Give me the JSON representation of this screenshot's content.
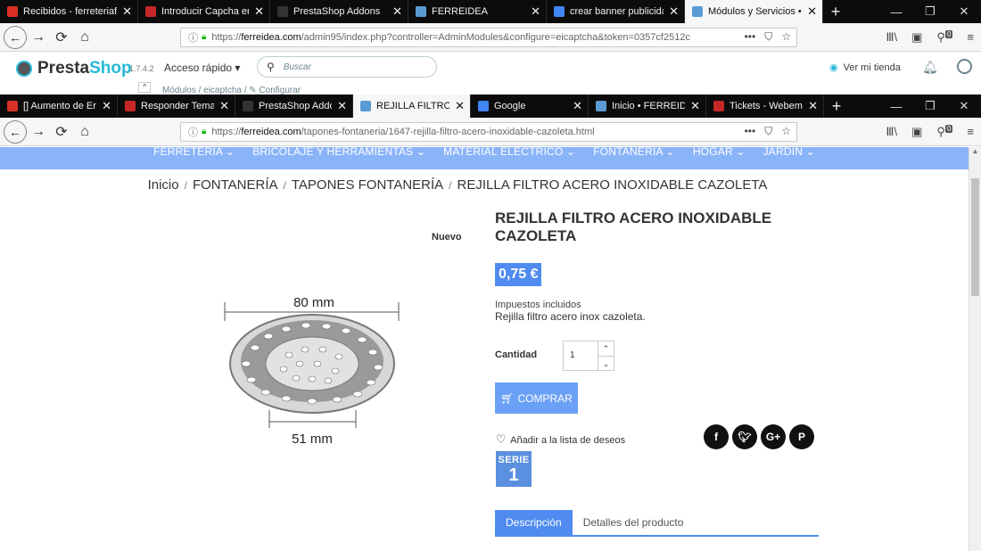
{
  "browser_back": {
    "tabs": [
      {
        "title": "Recibidos - ferreteriaferr",
        "favicon": "gmail-icon",
        "color": "#d93025",
        "w": 155
      },
      {
        "title": "Introducir Capcha en el f",
        "favicon": "webempresa-icon",
        "color": "#c62828",
        "w": 148
      },
      {
        "title": "PrestaShop Addons",
        "favicon": "prestashop-icon",
        "color": "#333333",
        "w": 155
      },
      {
        "title": "FERREIDEA",
        "favicon": "ferreidea-icon",
        "color": "#5b9bd5",
        "w": 155
      },
      {
        "title": "crear banner publicidad",
        "favicon": "google-icon",
        "color": "#4285f4",
        "w": 155
      },
      {
        "title": "Módulos y Servicios • FEI",
        "favicon": "ferreidea-icon",
        "color": "#5b9bd5",
        "w": 155,
        "active": true
      }
    ],
    "url_prefix": "https://",
    "url_domain": "ferreidea.com",
    "url_path": "/admin95/index.php?controller=AdminModules&configure=eicaptcha&token=0357cf2512c"
  },
  "ps_admin": {
    "logo_prefix": "Presta",
    "logo_suffix": "Shop",
    "version": "1.7.4.2",
    "quick_access": "Acceso rápido ▾",
    "search_placeholder": "Buscar",
    "view_shop": "Ver mi tienda",
    "breadcrumb": "Módulos  /  eicaptcha  /  ✎ Configurar"
  },
  "browser_front": {
    "tabs": [
      {
        "title": "[] Aumento de Erro",
        "favicon": "gmail-icon",
        "color": "#d93025",
        "w": 132
      },
      {
        "title": "Responder Tema: A",
        "favicon": "webempresa-icon",
        "color": "#c62828",
        "w": 132
      },
      {
        "title": "PrestaShop Addons",
        "favicon": "prestashop-icon",
        "color": "#333333",
        "w": 132
      },
      {
        "title": "REJILLA FILTRO ACE",
        "favicon": "ferreidea-icon",
        "color": "#5b9bd5",
        "w": 132,
        "active": true
      },
      {
        "title": "Google",
        "favicon": "google-icon",
        "color": "#4285f4",
        "w": 132
      },
      {
        "title": "Inicio • FERREIDEA",
        "favicon": "ferreidea-icon",
        "color": "#5b9bd5",
        "w": 132
      },
      {
        "title": "Tickets - Webempre",
        "favicon": "webempresa-icon",
        "color": "#c62828",
        "w": 132
      }
    ],
    "url_prefix": "https://",
    "url_domain": "ferreidea.com",
    "url_path": "/tapones-fontaneria/1647-rejilla-filtro-acero-inoxidable-cazoleta.html"
  },
  "shop": {
    "menu": [
      "FERRETERÍA ⌄",
      "BRICOLAJE Y HERRAMIENTAS ⌄",
      "MATERIAL ELÉCTRICO ⌄",
      "FONTANERÍA ⌄",
      "HOGAR ⌄",
      "JARDÍN ⌄"
    ],
    "breadcrumb": [
      "Inicio",
      "FONTANERÍA",
      "TAPONES FONTANERÍA",
      "REJILLA FILTRO ACERO INOXIDABLE CAZOLETA"
    ],
    "new_flag": "Nuevo",
    "product_title": "REJILLA FILTRO ACERO INOXIDABLE CAZOLETA",
    "price": "0,75 €",
    "taxes": "Impuestos incluidos",
    "short_description": "Rejilla filtro acero inox cazoleta.",
    "quantity_label": "Cantidad",
    "quantity_value": "1",
    "buy_label": "COMPRAR",
    "wishlist_label": "Añadir a la lista de deseos",
    "image_dim_top": "80 mm",
    "image_dim_bottom": "51 mm",
    "serie_line1": "SERIE",
    "serie_line2": "1",
    "tabs": [
      "Descripción",
      "Detalles del producto"
    ],
    "social_icons": [
      "facebook-icon",
      "twitter-icon",
      "googleplus-icon",
      "pinterest-icon"
    ],
    "accent": "#4f8bf0"
  }
}
